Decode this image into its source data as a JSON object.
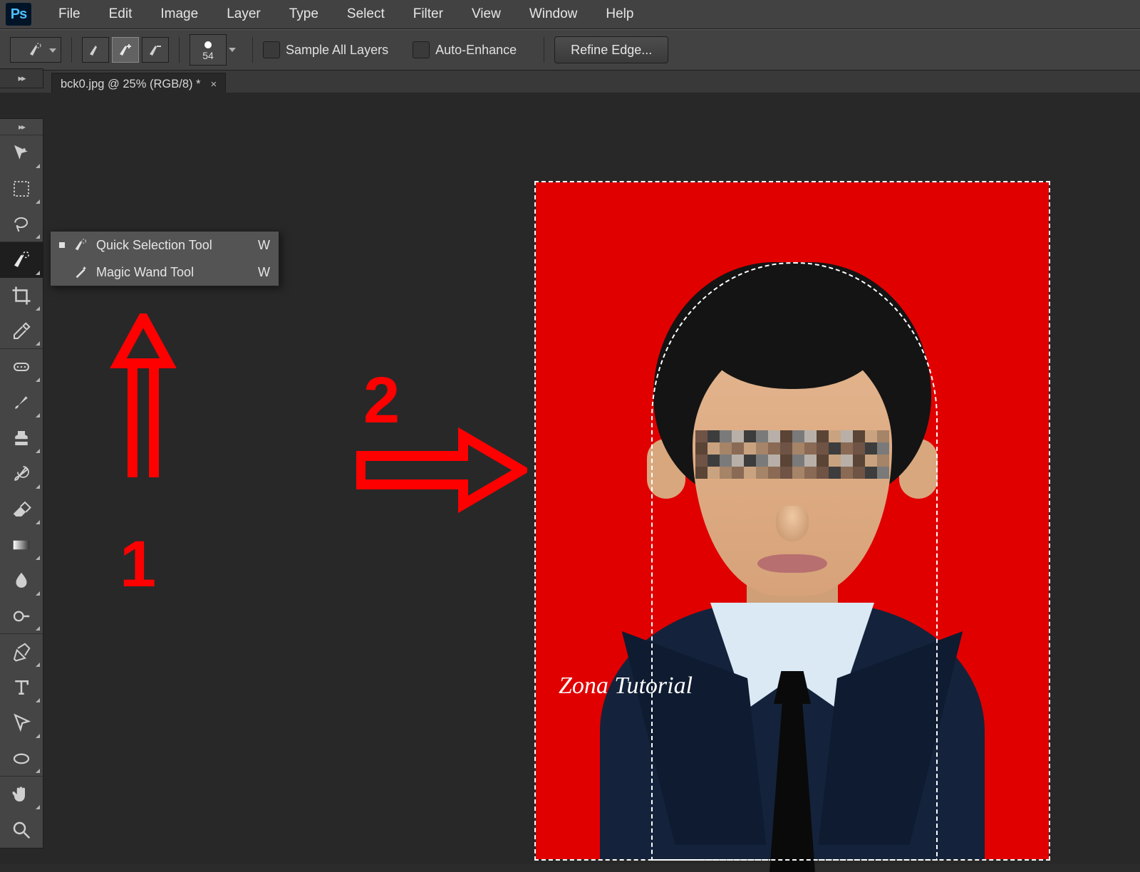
{
  "app_logo_text": "Ps",
  "menubar": [
    "File",
    "Edit",
    "Image",
    "Layer",
    "Type",
    "Select",
    "Filter",
    "View",
    "Window",
    "Help"
  ],
  "options": {
    "brush_size": "54",
    "sample_all_layers": "Sample All Layers",
    "auto_enhance": "Auto-Enhance",
    "refine_edge": "Refine Edge..."
  },
  "document_tab": {
    "title": "bck0.jpg @ 25% (RGB/8) *",
    "close_glyph": "×"
  },
  "toolbar_tools": [
    {
      "name": "move-tool",
      "sep": false
    },
    {
      "name": "marquee-tool",
      "sep": false
    },
    {
      "name": "lasso-tool",
      "sep": true
    },
    {
      "name": "quick-selection-tool",
      "sep": false,
      "active": true
    },
    {
      "name": "crop-tool",
      "sep": false
    },
    {
      "name": "eyedropper-tool",
      "sep": true
    },
    {
      "name": "healing-brush-tool",
      "sep": false
    },
    {
      "name": "brush-tool",
      "sep": false
    },
    {
      "name": "clone-stamp-tool",
      "sep": false
    },
    {
      "name": "history-brush-tool",
      "sep": false
    },
    {
      "name": "eraser-tool",
      "sep": false
    },
    {
      "name": "gradient-tool",
      "sep": false
    },
    {
      "name": "blur-tool",
      "sep": false
    },
    {
      "name": "dodge-tool",
      "sep": true
    },
    {
      "name": "pen-tool",
      "sep": false
    },
    {
      "name": "type-tool",
      "sep": false
    },
    {
      "name": "path-selection-tool",
      "sep": false
    },
    {
      "name": "shape-tool",
      "sep": true
    },
    {
      "name": "hand-tool",
      "sep": false
    },
    {
      "name": "zoom-tool",
      "sep": false
    }
  ],
  "flyout": {
    "items": [
      {
        "label": "Quick Selection Tool",
        "key": "W",
        "selected": true,
        "icon": "quick-selection-icon"
      },
      {
        "label": "Magic Wand Tool",
        "key": "W",
        "selected": false,
        "icon": "magic-wand-icon"
      }
    ]
  },
  "annotations": {
    "marker1": "1",
    "marker2": "2"
  },
  "canvas": {
    "watermark": "Zona Tutorial",
    "background_color": "#e10000"
  }
}
